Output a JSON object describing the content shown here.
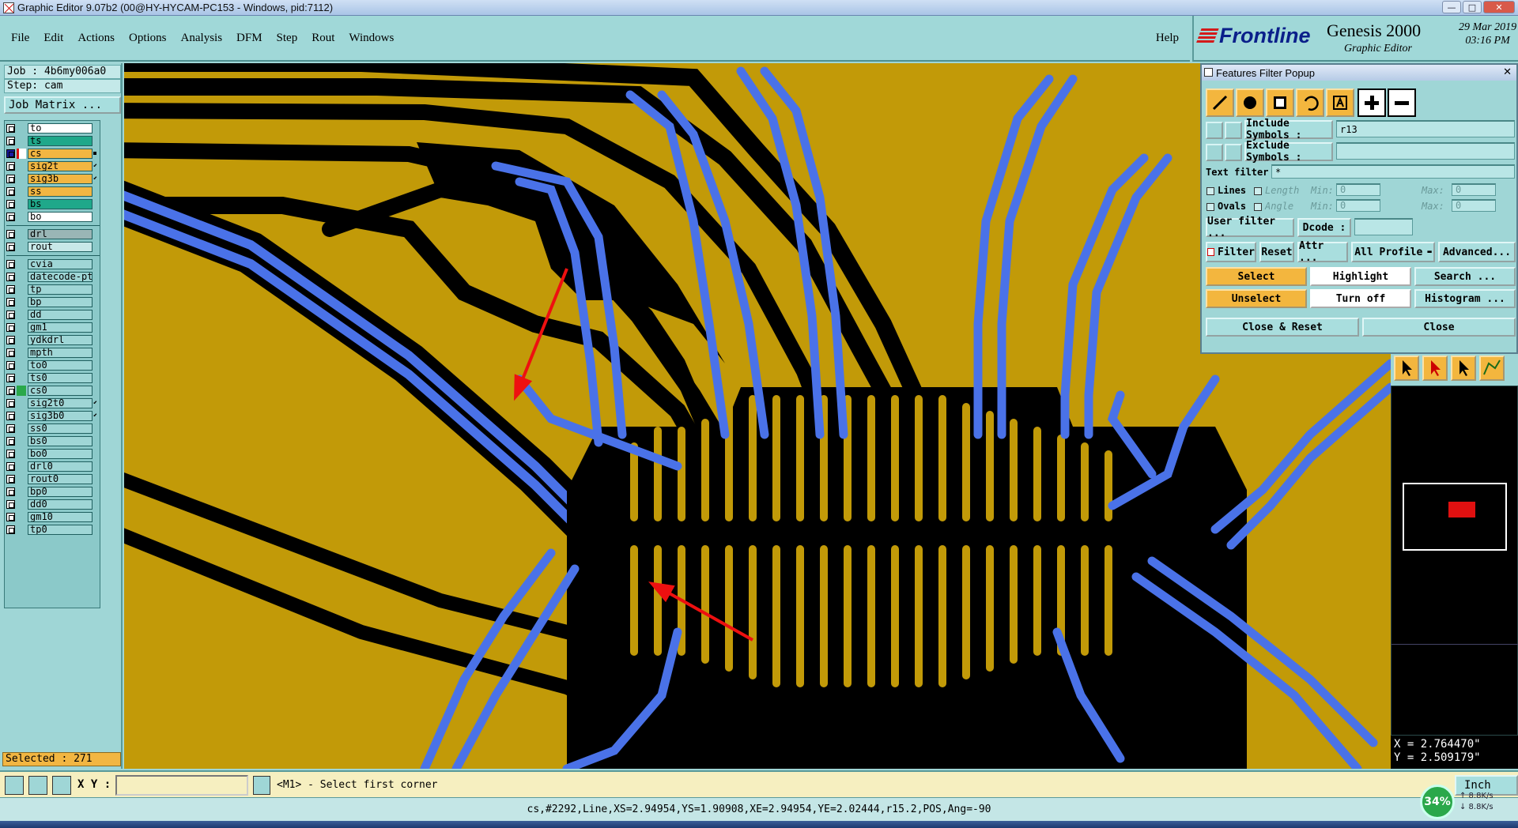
{
  "window": {
    "title": "Graphic Editor 9.07b2 (00@HY-HYCAM-PC153 - Windows, pid:7112)",
    "controls": [
      "—",
      "□",
      "✕"
    ]
  },
  "menu": {
    "items": [
      "File",
      "Edit",
      "Actions",
      "Options",
      "Analysis",
      "DFM",
      "Step",
      "Rout",
      "Windows"
    ],
    "help": "Help"
  },
  "brand": {
    "logo": "Frontline",
    "product": "Genesis 2000",
    "subtitle": "Graphic Editor",
    "date": "29 Mar 2019",
    "time": "03:16 PM"
  },
  "left": {
    "job": "Job : 4b6my006a0",
    "step": "Step: cam",
    "job_matrix": "Job Matrix ...",
    "selected": "Selected : 271",
    "layers": [
      {
        "name": "to",
        "color": "#ffffff"
      },
      {
        "name": "ts",
        "color": "#1fa88a"
      },
      {
        "name": "cs",
        "color": "#f2b642",
        "active": true
      },
      {
        "name": "sig2t",
        "color": "#f2b642",
        "arrow": true
      },
      {
        "name": "sig3b",
        "color": "#f2b642",
        "arrow": true
      },
      {
        "name": "ss",
        "color": "#f2b642"
      },
      {
        "name": "bs",
        "color": "#1fa88a"
      },
      {
        "name": "bo",
        "color": "#ffffff"
      },
      {
        "name": "drl",
        "color": "#9ab6b6",
        "gap": true
      },
      {
        "name": "rout",
        "color": "#c8e8e8"
      },
      {
        "name": "cvia",
        "color": "#9fd6d6",
        "gap": true
      },
      {
        "name": "datecode-pt",
        "color": "#9fd6d6"
      },
      {
        "name": "tp",
        "color": "#9fd6d6"
      },
      {
        "name": "bp",
        "color": "#9fd6d6"
      },
      {
        "name": "dd",
        "color": "#9fd6d6"
      },
      {
        "name": "gm1",
        "color": "#9fd6d6"
      },
      {
        "name": "ydkdrl",
        "color": "#9fd6d6"
      },
      {
        "name": "mpth",
        "color": "#9fd6d6"
      },
      {
        "name": "to0",
        "color": "#9fd6d6"
      },
      {
        "name": "ts0",
        "color": "#9fd6d6"
      },
      {
        "name": "cs0",
        "color": "#9fd6d6",
        "green": true
      },
      {
        "name": "sig2t0",
        "color": "#9fd6d6",
        "arrow": true
      },
      {
        "name": "sig3b0",
        "color": "#9fd6d6",
        "arrow": true
      },
      {
        "name": "ss0",
        "color": "#9fd6d6"
      },
      {
        "name": "bs0",
        "color": "#9fd6d6"
      },
      {
        "name": "bo0",
        "color": "#9fd6d6"
      },
      {
        "name": "drl0",
        "color": "#9fd6d6"
      },
      {
        "name": "rout0",
        "color": "#9fd6d6"
      },
      {
        "name": "bp0",
        "color": "#9fd6d6"
      },
      {
        "name": "dd0",
        "color": "#9fd6d6"
      },
      {
        "name": "gm10",
        "color": "#9fd6d6"
      },
      {
        "name": "tp0",
        "color": "#9fd6d6"
      }
    ]
  },
  "popup": {
    "title": "Features Filter Popup",
    "include_label": "Include Symbols :",
    "include_value": "r13",
    "exclude_label": "Exclude Symbols :",
    "exclude_value": "",
    "text_filter_label": "Text filter",
    "text_filter_value": "*",
    "lines_label": "Lines",
    "ovals_label": "Ovals",
    "length_label": "Length",
    "angle_label": "Angle",
    "min_label": "Min:",
    "max_label": "Max:",
    "zero": "0",
    "user_filter": "User filter ...",
    "dcode": "Dcode :",
    "filter": "Filter",
    "reset": "Reset",
    "attr": "Attr ...",
    "all_profile": "All Profile",
    "advanced": "Advanced...",
    "select": "Select",
    "highlight": "Highlight",
    "search": "Search ...",
    "unselect": "Unselect",
    "turn_off": "Turn off",
    "histogram": "Histogram ...",
    "close_reset": "Close & Reset",
    "close": "Close"
  },
  "coords": {
    "x": "X = 2.764470\"",
    "y": "Y = 2.509179\""
  },
  "cmd": {
    "xy_label": "X Y :",
    "xy_value": "",
    "prompt": "<M1> - Select first corner",
    "units": "Inch"
  },
  "status": "cs,#2292,Line,XS=2.94954,YS=1.90908,XE=2.94954,YE=2.02444,r15.2,POS,Ang=-90",
  "net": {
    "percent": "34%",
    "up": "↑ 8.8K/s",
    "down": "↓ 8.8K/s"
  },
  "colors": {
    "copper": "#c29a08",
    "trace": "#4a72e8",
    "clearance": "#000000",
    "arrow": "#ee1010"
  }
}
